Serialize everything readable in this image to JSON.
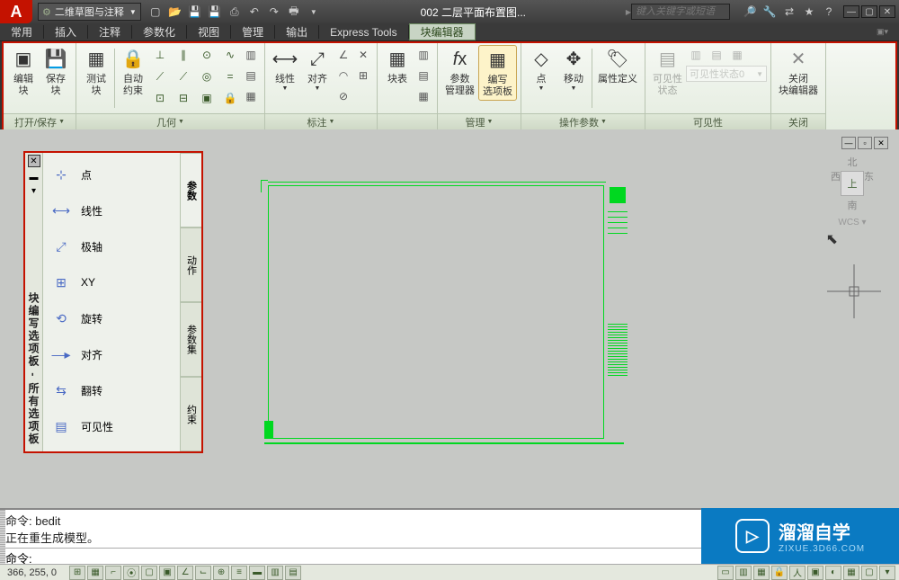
{
  "title": "002 二层平面布置图...",
  "workspace": "二维草图与注释",
  "search_placeholder": "键入关键字或短语",
  "menu": {
    "items": [
      "常用",
      "插入",
      "注释",
      "参数化",
      "视图",
      "管理",
      "输出",
      "Express Tools",
      "块编辑器"
    ],
    "active": "块编辑器"
  },
  "ribbon": {
    "panels": [
      {
        "title": "打开/保存",
        "buttons": [
          {
            "label": "编辑\n块"
          },
          {
            "label": "保存\n块"
          }
        ]
      },
      {
        "title": "几何",
        "buttons": [
          {
            "label": "测试\n块"
          },
          {
            "label": "自动\n约束"
          }
        ]
      },
      {
        "title": "标注",
        "buttons": [
          {
            "label": "线性"
          },
          {
            "label": "对齐"
          }
        ]
      },
      {
        "title": "",
        "single": "块表"
      },
      {
        "title": "管理",
        "buttons": [
          {
            "label": "参数\n管理器"
          },
          {
            "label": "编写\n选项板",
            "active": true
          }
        ]
      },
      {
        "title": "操作参数",
        "buttons": [
          {
            "label": "点"
          },
          {
            "label": "移动"
          },
          {
            "label": "属性定义"
          }
        ]
      },
      {
        "title": "可见性",
        "buttons": [
          {
            "label": "可见性\n状态"
          }
        ],
        "combo": "可见性状态0"
      },
      {
        "title": "关闭",
        "buttons": [
          {
            "label": "关闭\n块编辑器"
          }
        ]
      }
    ]
  },
  "palette": {
    "title": "块编写选项板 - 所有选项板",
    "tabs": [
      "参数",
      "动作",
      "参数集",
      "约束"
    ],
    "active_tab": "参数",
    "items": [
      "点",
      "线性",
      "极轴",
      "XY",
      "旋转",
      "对齐",
      "翻转",
      "可见性"
    ]
  },
  "viewcube": {
    "n": "北",
    "s": "南",
    "e": "东",
    "w": "西",
    "face": "上",
    "wcs": "WCS"
  },
  "command": {
    "hist1": "命令: bedit",
    "hist2": "正在重生成模型。",
    "prompt": "命令:"
  },
  "status": {
    "coords": "366, 255, 0"
  },
  "watermark": {
    "main": "溜溜自学",
    "sub": "ZIXUE.3D66.COM"
  }
}
